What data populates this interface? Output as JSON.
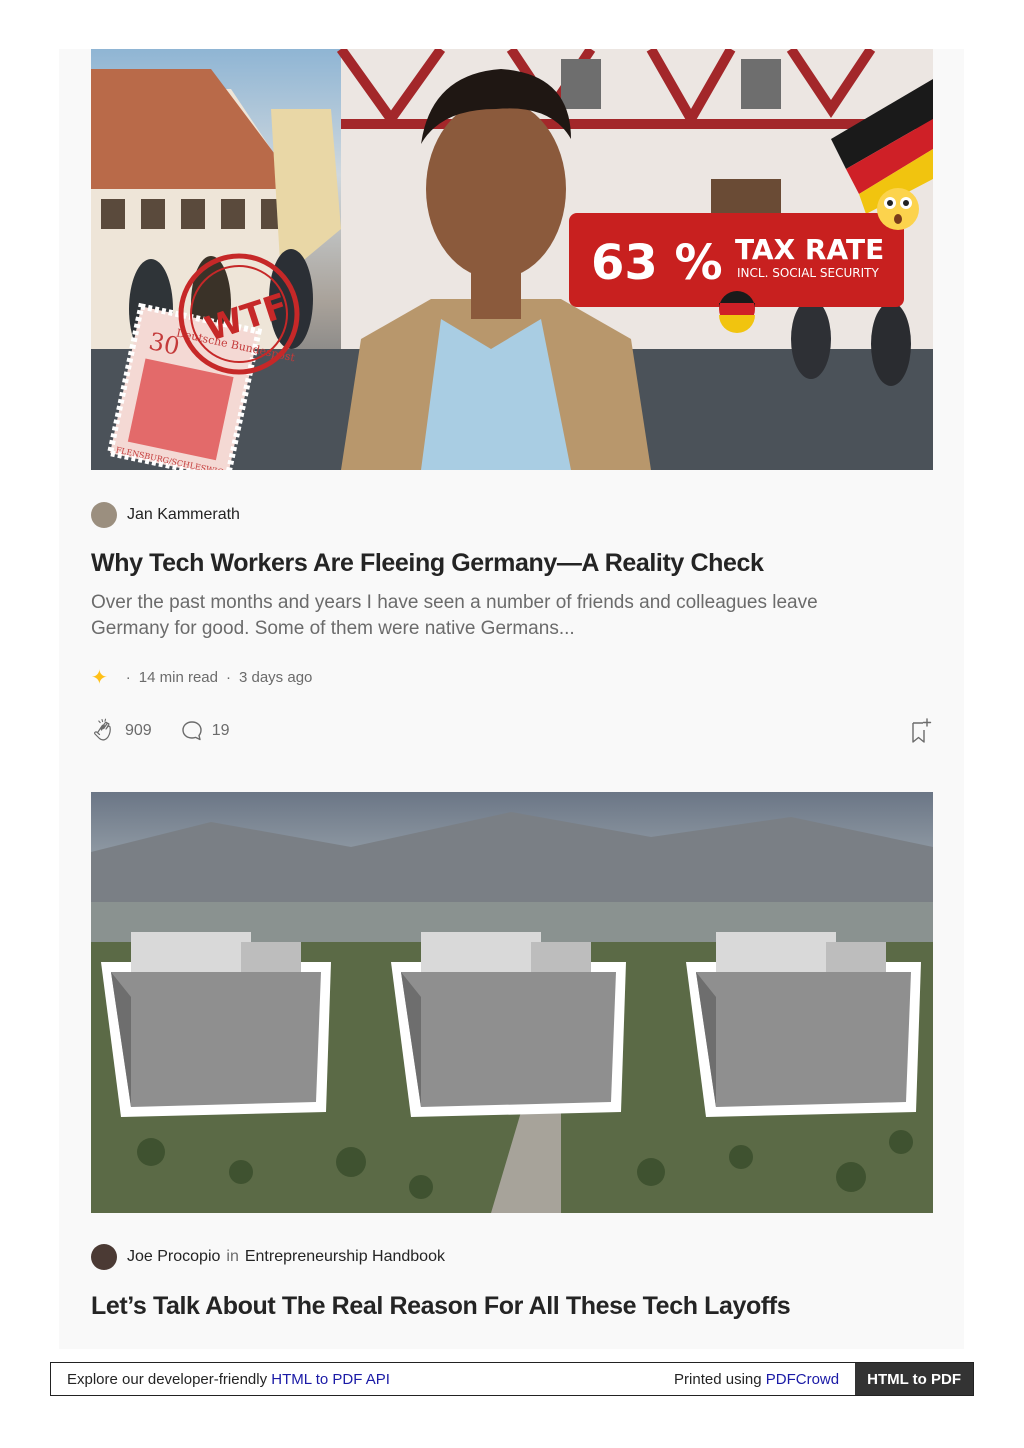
{
  "articles": [
    {
      "author": "Jan Kammerath",
      "title": "Why Tech Workers Are Fleeing Germany—A Reality Check",
      "subtitle": "Over the past months and years I have seen a number of friends and colleagues leave Germany for good. Some of them were native Germans...",
      "read_time": "14 min read",
      "posted": "3 days ago",
      "claps": "909",
      "responses": "19",
      "image": {
        "badge_pct": "63 %",
        "badge_title": "TAX RATE",
        "badge_sub": "INCL. SOCIAL SECURITY",
        "stamp_text": "WTF",
        "postage_value": "30",
        "postage_line1": "Deutsche Bundespost",
        "postage_line2": "FLENSBURG/SCHLESWIG"
      }
    },
    {
      "author": "Joe Procopio",
      "in_word": "in",
      "publication": "Entrepreneurship Handbook",
      "title": "Let’s Talk About The Real Reason For All These Tech Layoffs"
    }
  ],
  "footer": {
    "prefix": "Explore our developer-friendly ",
    "api_link": "HTML to PDF API",
    "printed_prefix": "Printed using ",
    "printed_link": "PDFCrowd",
    "button": "HTML to PDF"
  },
  "colors": {
    "accent_star": "#ffc017",
    "badge_red": "#c8201f",
    "link_blue": "#1a1aa6"
  }
}
